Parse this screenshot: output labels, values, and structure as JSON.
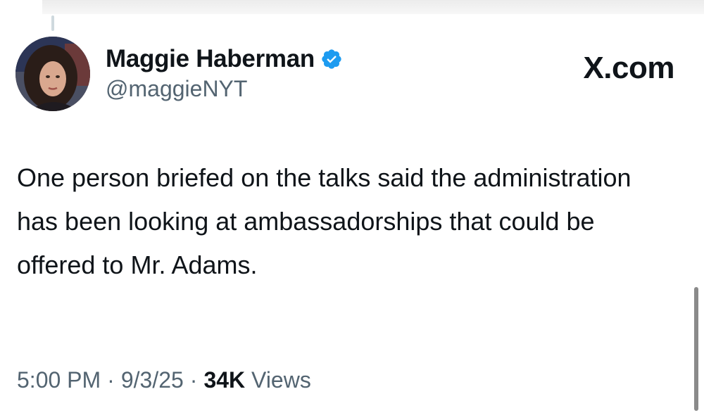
{
  "author": {
    "display_name": "Maggie Haberman",
    "handle": "@maggieNYT",
    "verified": true,
    "verified_color": "#1d9bf0"
  },
  "site": {
    "label": "X.com"
  },
  "tweet": {
    "text": "One person briefed on the talks said the administration has been looking at ambassadorships that could be offered to Mr. Adams."
  },
  "meta": {
    "time": "5:00 PM",
    "separator": "·",
    "date": "9/3/25",
    "views_count": "34K",
    "views_label": "Views"
  }
}
